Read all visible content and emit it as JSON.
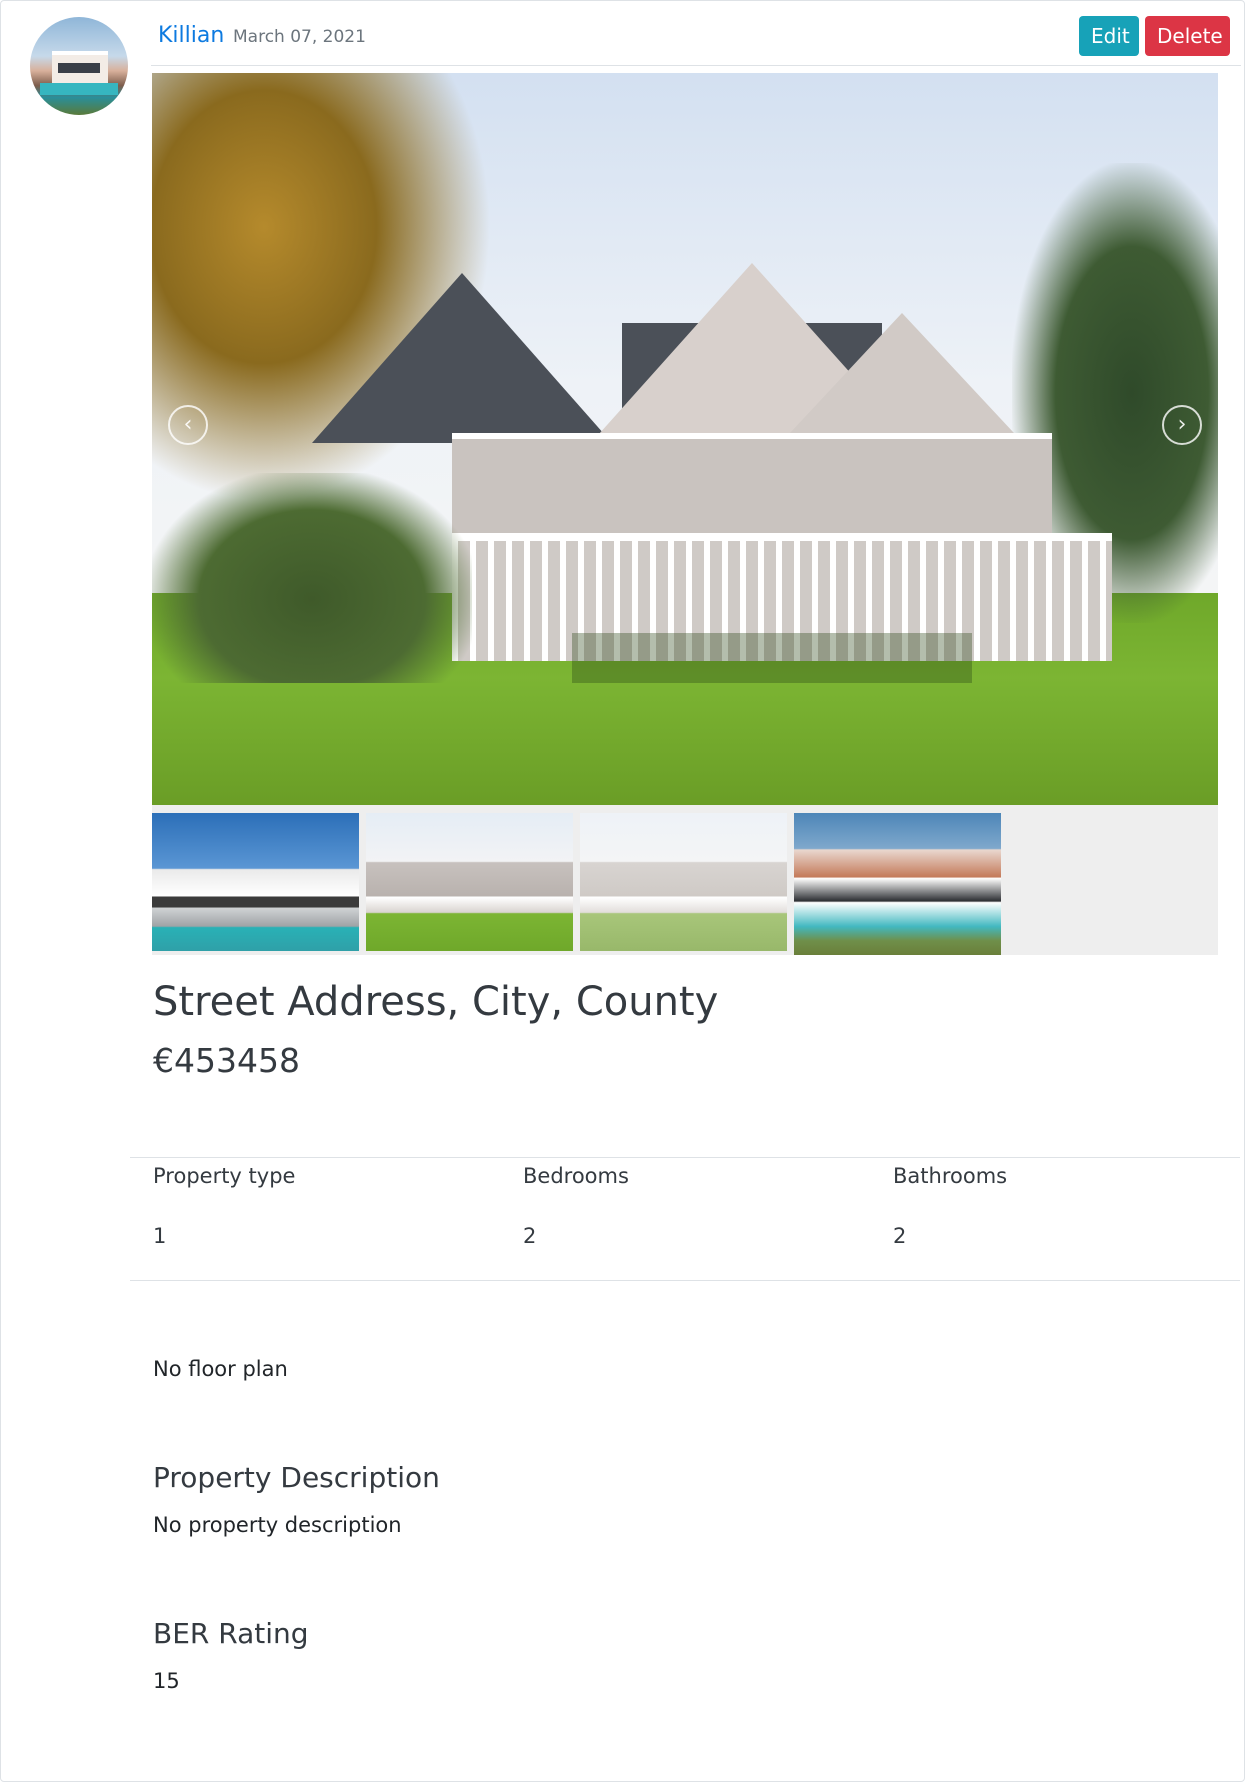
{
  "post": {
    "author": "Killian",
    "date": "March 07, 2021",
    "edit_label": "Edit",
    "delete_label": "Delete"
  },
  "carousel": {
    "prev_icon": "chevron-left-icon",
    "next_icon": "chevron-right-icon",
    "prev_glyph": "‹",
    "next_glyph": "›",
    "thumbnail_count": 4
  },
  "listing": {
    "address": "Street Address, City, County",
    "price": "€453458"
  },
  "specs": [
    {
      "label": "Property type",
      "value": "1"
    },
    {
      "label": "Bedrooms",
      "value": "2"
    },
    {
      "label": "Bathrooms",
      "value": "2"
    }
  ],
  "floor_plan": "No floor plan",
  "description": {
    "title": "Property Description",
    "text": "No property description"
  },
  "ber": {
    "title": "BER Rating",
    "value": "15"
  },
  "colors": {
    "link": "#0d7ae0",
    "edit_button": "#17a2b8",
    "delete_button": "#dc3545"
  }
}
